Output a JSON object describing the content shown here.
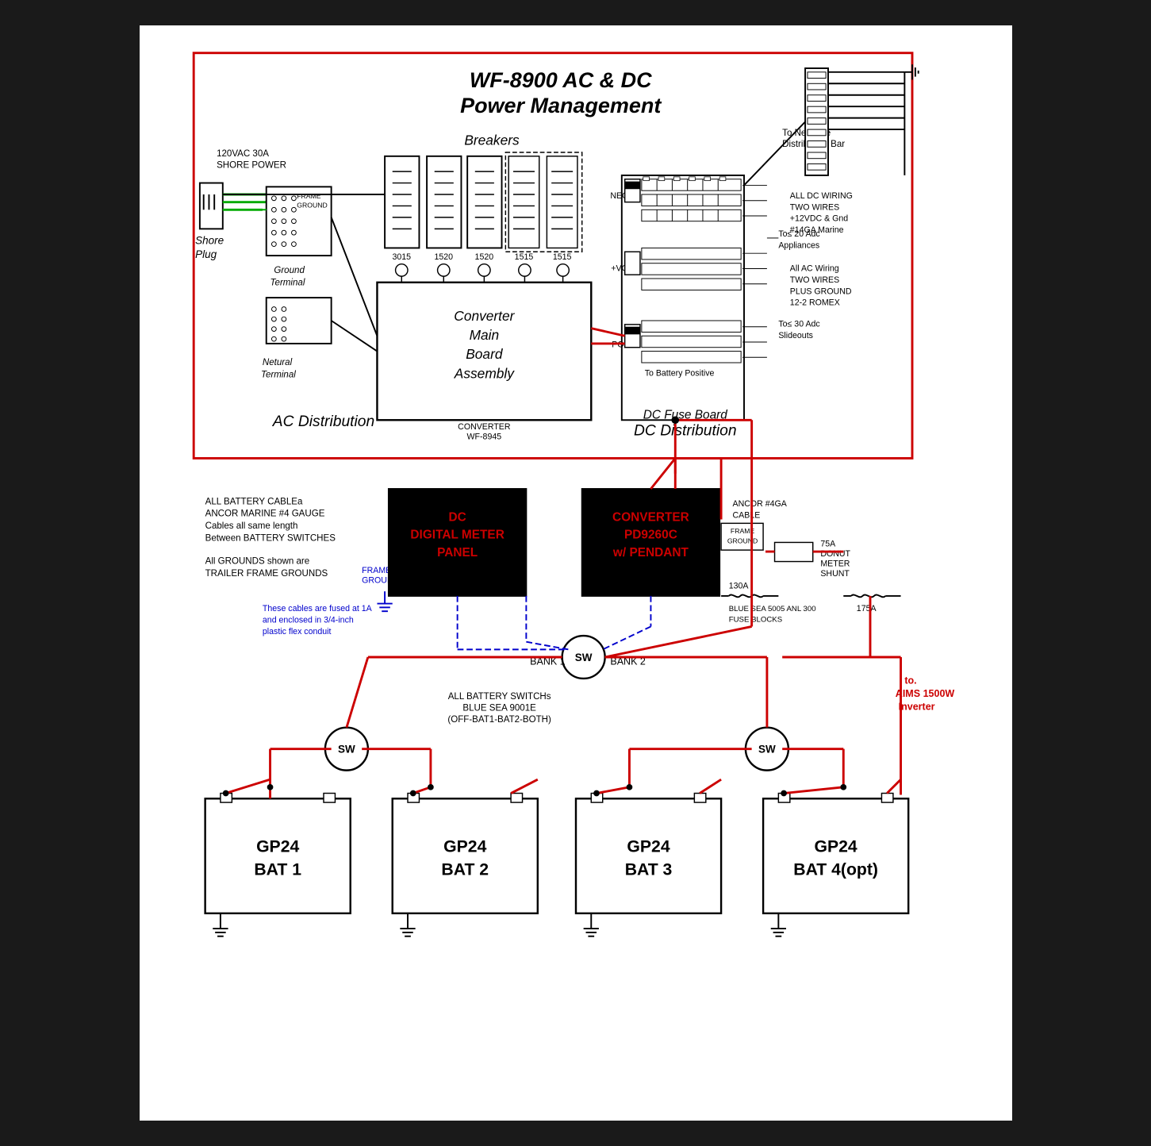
{
  "title": "WF-8900 AC & DC Power Management",
  "diagram": {
    "main_title_line1": "WF-8900 AC & DC",
    "main_title_line2": "Power Management",
    "ac_distribution_label": "AC Distribution",
    "dc_distribution_label": "DC Distribution",
    "dc_fuse_board_label": "DC Fuse Board",
    "breakers_label": "Breakers",
    "converter_label": "Converter\nMain\nBoard\nAssembly",
    "converter_part": "CONVERTER\nWF-8945",
    "shore_plug_label": "Shore\nPlug",
    "frame_ground_label": "FRAME\nGROUND",
    "ground_terminal_label": "Ground\nTerminal",
    "neutral_terminal_label": "Netural\nTerminal",
    "shore_power_label": "120VAC 30A\nSHORE POWER",
    "neg_label": "NEG-",
    "pos_label": "POS",
    "vcc_label": "+VCC",
    "to_neg_dist": "To Negative\nDistribution Bar",
    "to_20adc": "To≤ 20 Adc\nAppliances",
    "to_30adc": "To≤ 30 Adc\nSlideouts",
    "to_battery_positive": "To Battery Positive",
    "dc_wiring_note": "ALL DC WIRING\nTWO WIRES\n+12VDC & Gnd\n#14GA Marine",
    "ac_wiring_note": "All AC Wiring\nTWO WIRES\nPLUS GROUND\n12-2 ROMEX",
    "breaker_values": [
      "3015",
      "1520",
      "1520",
      "1515",
      "1515"
    ],
    "battery_cable_note": "ALL BATTERY CABLEa\nANCOR MARINE #4 GAUGE\nCables all same length\nBetween BATTERY SWITCHES",
    "grounds_note": "All GROUNDS shown are\nTRAILER FRAME GROUNDS",
    "fused_note": "These cables are fused at 1A\nand enclosed in 3/4-inch\nplastic flex conduit",
    "frame_ground_lower": "FRAME\nGROUND",
    "frame_ground_box": "FRAME\nGROUND",
    "bank1_label": "BANK 1",
    "bank2_label": "BANK 2",
    "battery_switches_note": "ALL BATTERY SWITCHs\nBLUE SEA 9001E\n(OFF-BAT1-BAT2-BOTH)",
    "dc_meter_panel_label": "DC\nDIGITAL METER\nPANEL",
    "converter_panel_label": "CONVERTER\nPD9260C\nw/ PENDANT",
    "ancor_cable": "ANCOR #4GA\nCABLE",
    "donut_meter": "75A\nDONUT\nMETER\nSHUNT",
    "fuse_block_1": "130A\nBLUE SEA 5005 ANL 300\nFUSE BLOCKS",
    "fuse_block_2": "175A",
    "aims_label": "to.\nAIMS 1500W\nInverter",
    "batteries": [
      {
        "label": "GP24\nBAT 1"
      },
      {
        "label": "GP24\nBAT 2"
      },
      {
        "label": "GP24\nBAT 3"
      },
      {
        "label": "GP24\nBAT 4(opt)"
      }
    ]
  }
}
